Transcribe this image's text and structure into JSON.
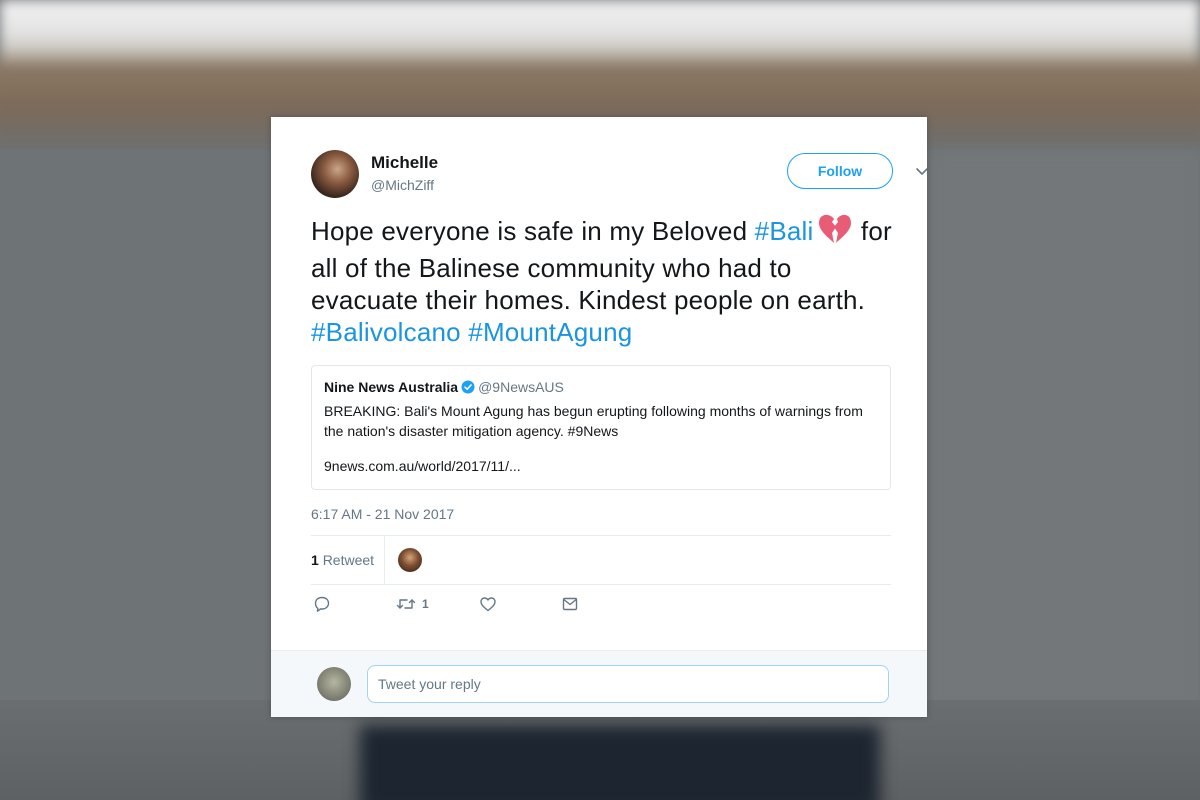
{
  "tweet": {
    "author_name": "Michelle",
    "author_handle": "@MichZiff",
    "follow_label": "Follow",
    "text_parts": {
      "p1": "Hope everyone is safe in my Beloved ",
      "h1": "#Bali",
      "p2": " for all of the Balinese community who had to evacuate their homes. Kindest people on earth. ",
      "h2": "#Balivolcano",
      "h3": "#MountAgung"
    },
    "emoji": "broken-heart",
    "timestamp": "6:17 AM - 21 Nov 2017",
    "retweet_count": "1",
    "retweet_label": "Retweet",
    "action_retweet_count": "1"
  },
  "quote": {
    "name": "Nine News Australia",
    "handle": "@9NewsAUS",
    "body": "BREAKING: Bali's Mount Agung has begun erupting following months of warnings from the nation's disaster mitigation agency. #9News",
    "link": "9news.com.au/world/2017/11/..."
  },
  "reply": {
    "placeholder": "Tweet your reply"
  },
  "colors": {
    "accent": "#1da1f2",
    "hashtag": "#1b95e0",
    "emoji": "#e85d75"
  },
  "icons": [
    "caret-down-icon",
    "verified-badge-icon",
    "reply-icon",
    "retweet-icon",
    "like-icon",
    "message-icon",
    "broken-heart-emoji"
  ]
}
